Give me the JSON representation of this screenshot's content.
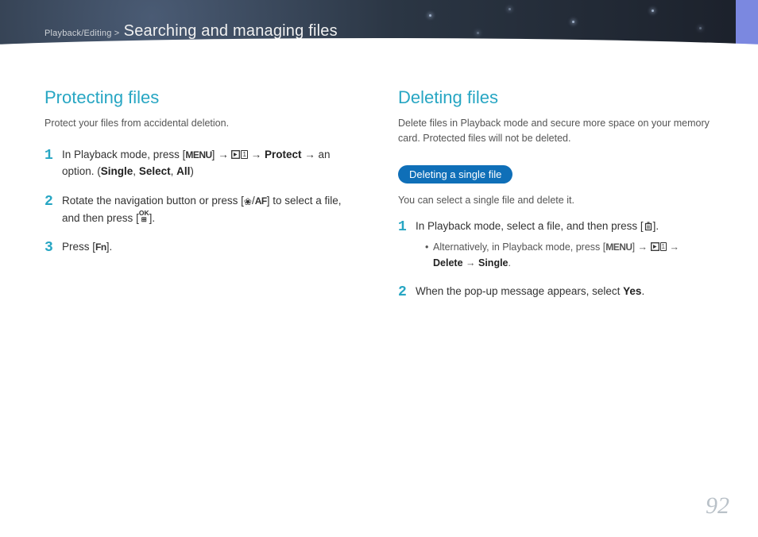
{
  "header": {
    "breadcrumb_prefix": "Playback/Editing >",
    "title": "Searching and managing files"
  },
  "left": {
    "heading": "Protecting files",
    "lead": "Protect your files from accidental deletion.",
    "step1_a": "In Playback mode, press [",
    "menu": "MENU",
    "arrow": "→",
    "protect": "Protect",
    "step1_b": "an option. (",
    "single": "Single",
    "select": "Select",
    "all": "All",
    "step2_a": "Rotate the navigation button or press [",
    "af": "AF",
    "step2_b": "] to select a file, and then press [",
    "step2_c": "].",
    "step3_a": "Press [",
    "fn": "Fn",
    "step3_b": "]."
  },
  "right": {
    "heading": "Deleting files",
    "lead": "Delete files in Playback mode and secure more space on your memory card. Protected files will not be deleted.",
    "pill": "Deleting a single file",
    "sub": "You can select a single file and delete it.",
    "step1_a": "In Playback mode, select a file, and then press [",
    "step1_b": "].",
    "alt_a": "Alternatively, in Playback mode, press [",
    "delete": "Delete",
    "single": "Single",
    "step2_a": "When the pop-up message appears, select ",
    "yes": "Yes",
    "step2_b": "."
  },
  "page_number": "92"
}
